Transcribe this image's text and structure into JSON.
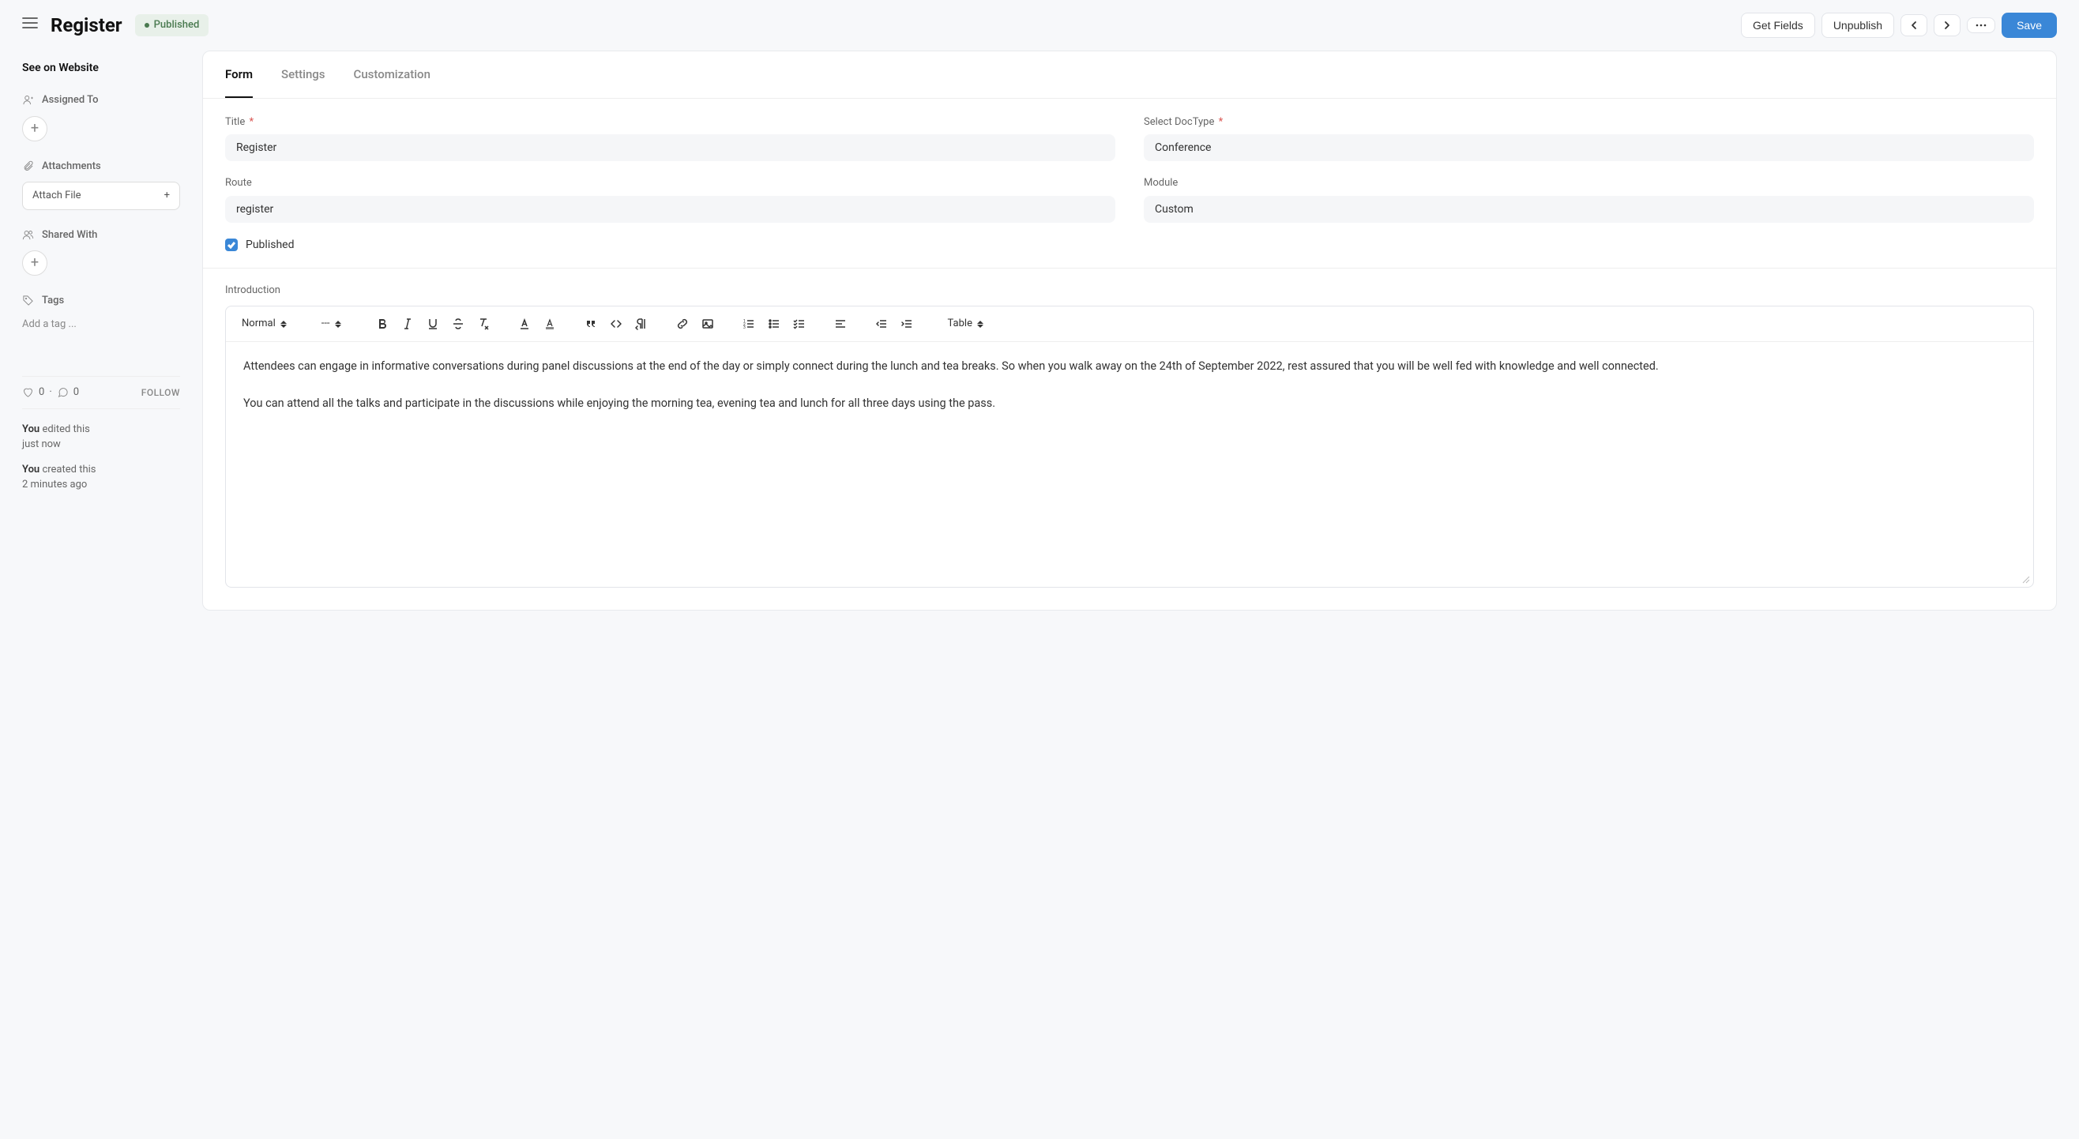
{
  "header": {
    "title": "Register",
    "status_label": "Published",
    "buttons": {
      "get_fields": "Get Fields",
      "unpublish": "Unpublish",
      "save": "Save"
    }
  },
  "sidebar": {
    "see_on_website": "See on Website",
    "assigned_to_label": "Assigned To",
    "attachments_label": "Attachments",
    "attach_file_label": "Attach File",
    "shared_with_label": "Shared With",
    "tags_label": "Tags",
    "add_tag_placeholder": "Add a tag ...",
    "likes": "0",
    "dot": "·",
    "comments": "0",
    "follow_label": "FOLLOW",
    "activity": [
      {
        "user": "You",
        "action": "edited this",
        "time": "just now"
      },
      {
        "user": "You",
        "action": "created this",
        "time": "2 minutes ago"
      }
    ]
  },
  "tabs": {
    "form": "Form",
    "settings": "Settings",
    "customization": "Customization"
  },
  "form": {
    "title_label": "Title",
    "title_value": "Register",
    "doctype_label": "Select DocType",
    "doctype_value": "Conference",
    "route_label": "Route",
    "route_value": "register",
    "module_label": "Module",
    "module_value": "Custom",
    "published_label": "Published",
    "published_checked": true,
    "introduction_label": "Introduction"
  },
  "toolbar": {
    "heading_select": "Normal",
    "size_select": "---",
    "table_select": "Table"
  },
  "editor": {
    "para1": "Attendees can engage in informative conversations during panel discussions at the end of the day or simply connect during the lunch and tea breaks. So when you walk away on the 24th of September 2022, rest assured that you will be well fed with knowledge and well connected.",
    "para2": "You can attend all the talks and participate in the discussions while enjoying the morning tea, evening tea and lunch for all three days using the pass."
  }
}
